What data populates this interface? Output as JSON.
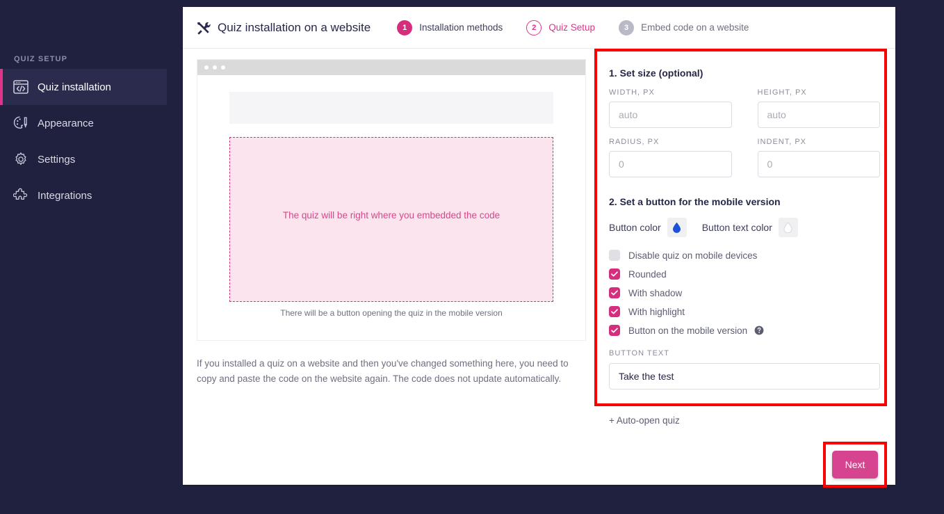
{
  "sidebar": {
    "caption": "QUIZ SETUP",
    "items": [
      {
        "label": "Quiz installation",
        "icon": "code-window-icon",
        "active": true
      },
      {
        "label": "Appearance",
        "icon": "palette-icon",
        "active": false
      },
      {
        "label": "Settings",
        "icon": "gear-icon",
        "active": false
      },
      {
        "label": "Integrations",
        "icon": "puzzle-piece-icon",
        "active": false
      }
    ]
  },
  "header": {
    "icon": "tools-icon",
    "title": "Quiz installation on a website",
    "steps": [
      {
        "number": "1",
        "label": "Installation methods",
        "state": "done"
      },
      {
        "number": "2",
        "label": "Quiz Setup",
        "state": "current"
      },
      {
        "number": "3",
        "label": "Embed code on a website",
        "state": "upcoming"
      }
    ]
  },
  "preview": {
    "dots": 3,
    "placeholder_text": "The quiz will be right where you embedded the code",
    "caption": "There will be a button opening the quiz in the mobile version",
    "footer_note": "If you installed a quiz on a website and then you've changed something here, you need to copy and paste the code on the website again. The code does not update automatically."
  },
  "panel": {
    "section1_title": "1. Set size (optional)",
    "fields": [
      {
        "label": "WIDTH, PX",
        "value": "",
        "placeholder": "auto"
      },
      {
        "label": "HEIGHT, PX",
        "value": "",
        "placeholder": "auto"
      },
      {
        "label": "RADIUS, PX",
        "value": "",
        "placeholder": "0"
      },
      {
        "label": "INDENT, PX",
        "value": "",
        "placeholder": "0"
      }
    ],
    "section2_title": "2. Set a button for the mobile version",
    "button_color_label": "Button color",
    "button_text_color_label": "Button text color",
    "button_color_value": "#1b52d6",
    "button_text_color_value": "#ffffff",
    "checkboxes": [
      {
        "label": "Disable quiz on mobile devices",
        "checked": false,
        "help": false
      },
      {
        "label": "Rounded",
        "checked": true,
        "help": false
      },
      {
        "label": "With shadow",
        "checked": true,
        "help": false
      },
      {
        "label": "With highlight",
        "checked": true,
        "help": false
      },
      {
        "label": "Button on the mobile version",
        "checked": true,
        "help": true
      }
    ],
    "button_text_label": "BUTTON TEXT",
    "button_text_value": "Take the test",
    "auto_open_label": "+ Auto-open quiz",
    "next_label": "Next"
  },
  "colors": {
    "accent_pink": "#d62e7e",
    "annotation_red": "#fb0000",
    "sidebar_bg": "#20213f",
    "dashed_fill": "#fbe4ee"
  }
}
